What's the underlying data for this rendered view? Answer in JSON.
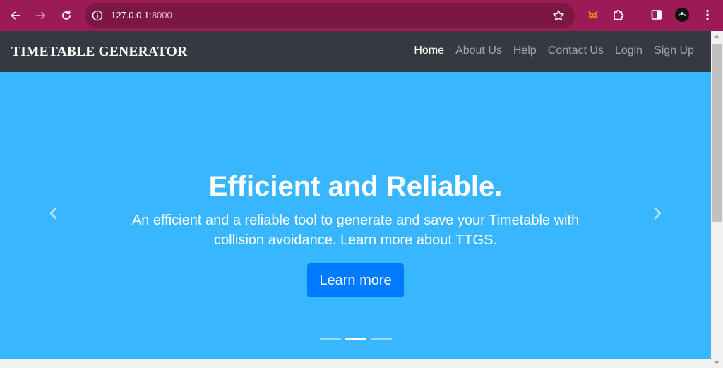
{
  "browser": {
    "url_host": "127.0.0.1",
    "url_port": ":8000",
    "icons": [
      "back-arrow-icon",
      "forward-arrow-icon",
      "reload-icon",
      "site-info-icon",
      "bookmark-star-icon",
      "metamask-fox-icon",
      "extensions-puzzle-icon",
      "side-panel-icon",
      "profile-avatar-icon",
      "menu-kebab-icon"
    ],
    "chrome_color": "#9c1a57"
  },
  "navbar": {
    "brand": "TIMETABLE GENERATOR",
    "links": [
      {
        "label": "Home",
        "active": true
      },
      {
        "label": "About Us",
        "active": false
      },
      {
        "label": "Help",
        "active": false
      },
      {
        "label": "Contact Us",
        "active": false
      },
      {
        "label": "Login",
        "active": false
      },
      {
        "label": "Sign Up",
        "active": false
      }
    ],
    "background": "#343a40"
  },
  "carousel": {
    "background": "#38b6ff",
    "heading": "Efficient and Reliable.",
    "text": "An efficient and a reliable tool to generate and save your Timetable with collision avoidance. Learn more about TTGS.",
    "button_label": "Learn more",
    "button_color": "#007bff",
    "slide_count": 3,
    "active_slide": 2
  }
}
